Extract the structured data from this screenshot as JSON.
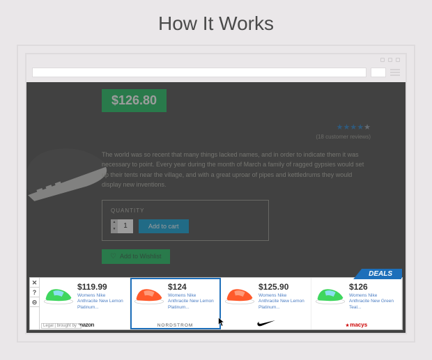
{
  "page": {
    "title": "How It Works"
  },
  "product": {
    "price": "$126.80",
    "rating": 4,
    "reviews_text": "(18 customer reviews)",
    "description": "The world was so recent that many things lacked names, and in order to indicate them it was necessary to point. Every year during the month of March a family of ragged gypsies would set up their tents near the village, and with a great uproar of pipes and kettledrums they would display new inventions.",
    "quantity_label": "QUANTITY",
    "quantity": "1",
    "add_to_cart": "Add to cart",
    "wishlist": "Add to Wishlist"
  },
  "deals": {
    "badge": "DEALS",
    "legal": "Legal | brought by",
    "controls": {
      "close": "✕",
      "help": "?",
      "settings": "⊝"
    },
    "items": [
      {
        "price": "$119.99",
        "title": "Womens Nike Anthracite New Lemon Platinum...",
        "vendor": "amazon",
        "shoe": "green",
        "selected": false
      },
      {
        "price": "$124",
        "title": "Womens Nike Anthracite New Lemon Platinum...",
        "vendor": "NORDSTROM",
        "shoe": "orange",
        "selected": true
      },
      {
        "price": "$125.90",
        "title": "Womens Nike Anthracite New Lemon Platinum...",
        "vendor": "nike",
        "shoe": "orange",
        "selected": false
      },
      {
        "price": "$126",
        "title": "Womens Nike Anthracite New Green Teal...",
        "vendor": "macys",
        "shoe": "green",
        "selected": false
      }
    ]
  }
}
